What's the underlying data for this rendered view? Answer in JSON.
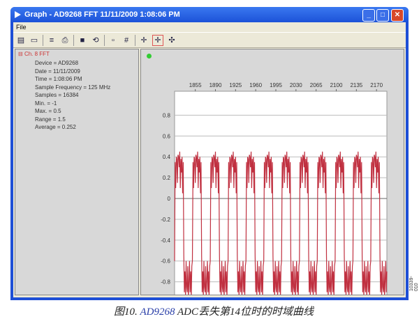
{
  "window": {
    "title": "Graph - AD9268 FFT 11/11/2009 1:08:06 PM",
    "minimize": "_",
    "maximize": "□",
    "close": "✕"
  },
  "menu": {
    "file": "File"
  },
  "toolbar": [
    {
      "icon": "open-icon",
      "glyph": "▤"
    },
    {
      "icon": "window-icon",
      "glyph": "▭"
    },
    {
      "icon": "list-icon",
      "glyph": "≡"
    },
    {
      "icon": "print-icon",
      "glyph": "⎙"
    },
    {
      "icon": "save-icon",
      "glyph": "■"
    },
    {
      "icon": "refresh-icon",
      "glyph": "⟲"
    },
    {
      "icon": "note-icon",
      "glyph": "▫"
    },
    {
      "icon": "grid-icon",
      "glyph": "#"
    },
    {
      "icon": "crosshair-icon",
      "glyph": "✛"
    },
    {
      "icon": "zoom-crosshair-icon",
      "glyph": "✛",
      "selected": true
    },
    {
      "icon": "pan-crosshair-icon",
      "glyph": "✣"
    }
  ],
  "tree": {
    "header": "Ch. 8 FFT",
    "items": [
      "Device = AD9268",
      "Date = 11/11/2009",
      "Time = 1:08:06 PM",
      "Sample Frequency = 125 MHz",
      "Samples = 16384",
      "Min. = -1",
      "Max. = 0.5",
      "Range = 1.5",
      "Average = 0.252"
    ]
  },
  "chart_data": {
    "type": "line",
    "title": "",
    "xlabel": "",
    "ylabel": "",
    "xlim": [
      1819,
      2188
    ],
    "ylim": [
      -1.03,
      1.03
    ],
    "x_ticks": [
      "1855",
      "1890",
      "1925",
      "1960",
      "1995",
      "2030",
      "2065",
      "2100",
      "2135",
      "2170"
    ],
    "x_tick_values": [
      1855,
      1890,
      1925,
      1960,
      1995,
      2030,
      2065,
      2100,
      2135,
      2170
    ],
    "y_ticks": [
      "0.8",
      "0.6",
      "0.4",
      "0.2",
      "0",
      "-0.2",
      "-0.4",
      "-0.6",
      "-0.8"
    ],
    "y_tick_values": [
      0.8,
      0.6,
      0.4,
      0.2,
      0,
      -0.2,
      -0.4,
      -0.6,
      -0.8
    ],
    "grid": true,
    "series": [
      {
        "name": "Ch. 8",
        "color": "#c03040",
        "x_start": 1819,
        "period_pattern": [
          -0.6,
          0.35,
          0.1,
          0.4,
          0.38,
          0.15,
          0.42,
          0.4,
          0.3,
          0.45,
          0.1,
          0.38,
          0.25,
          0.4,
          0.05,
          0.35,
          -0.55,
          -0.9,
          -0.7,
          -0.95,
          -0.6,
          -0.85,
          -0.9,
          -0.65,
          -0.95,
          -0.8,
          -0.6,
          -0.9,
          -0.7,
          -0.95,
          -0.65
        ]
      }
    ]
  },
  "caption": {
    "prefix": "图10. ",
    "model": "AD9268",
    "suffix": " ADC丢失第14位时的时域曲线"
  },
  "figure_id": "10339-010"
}
